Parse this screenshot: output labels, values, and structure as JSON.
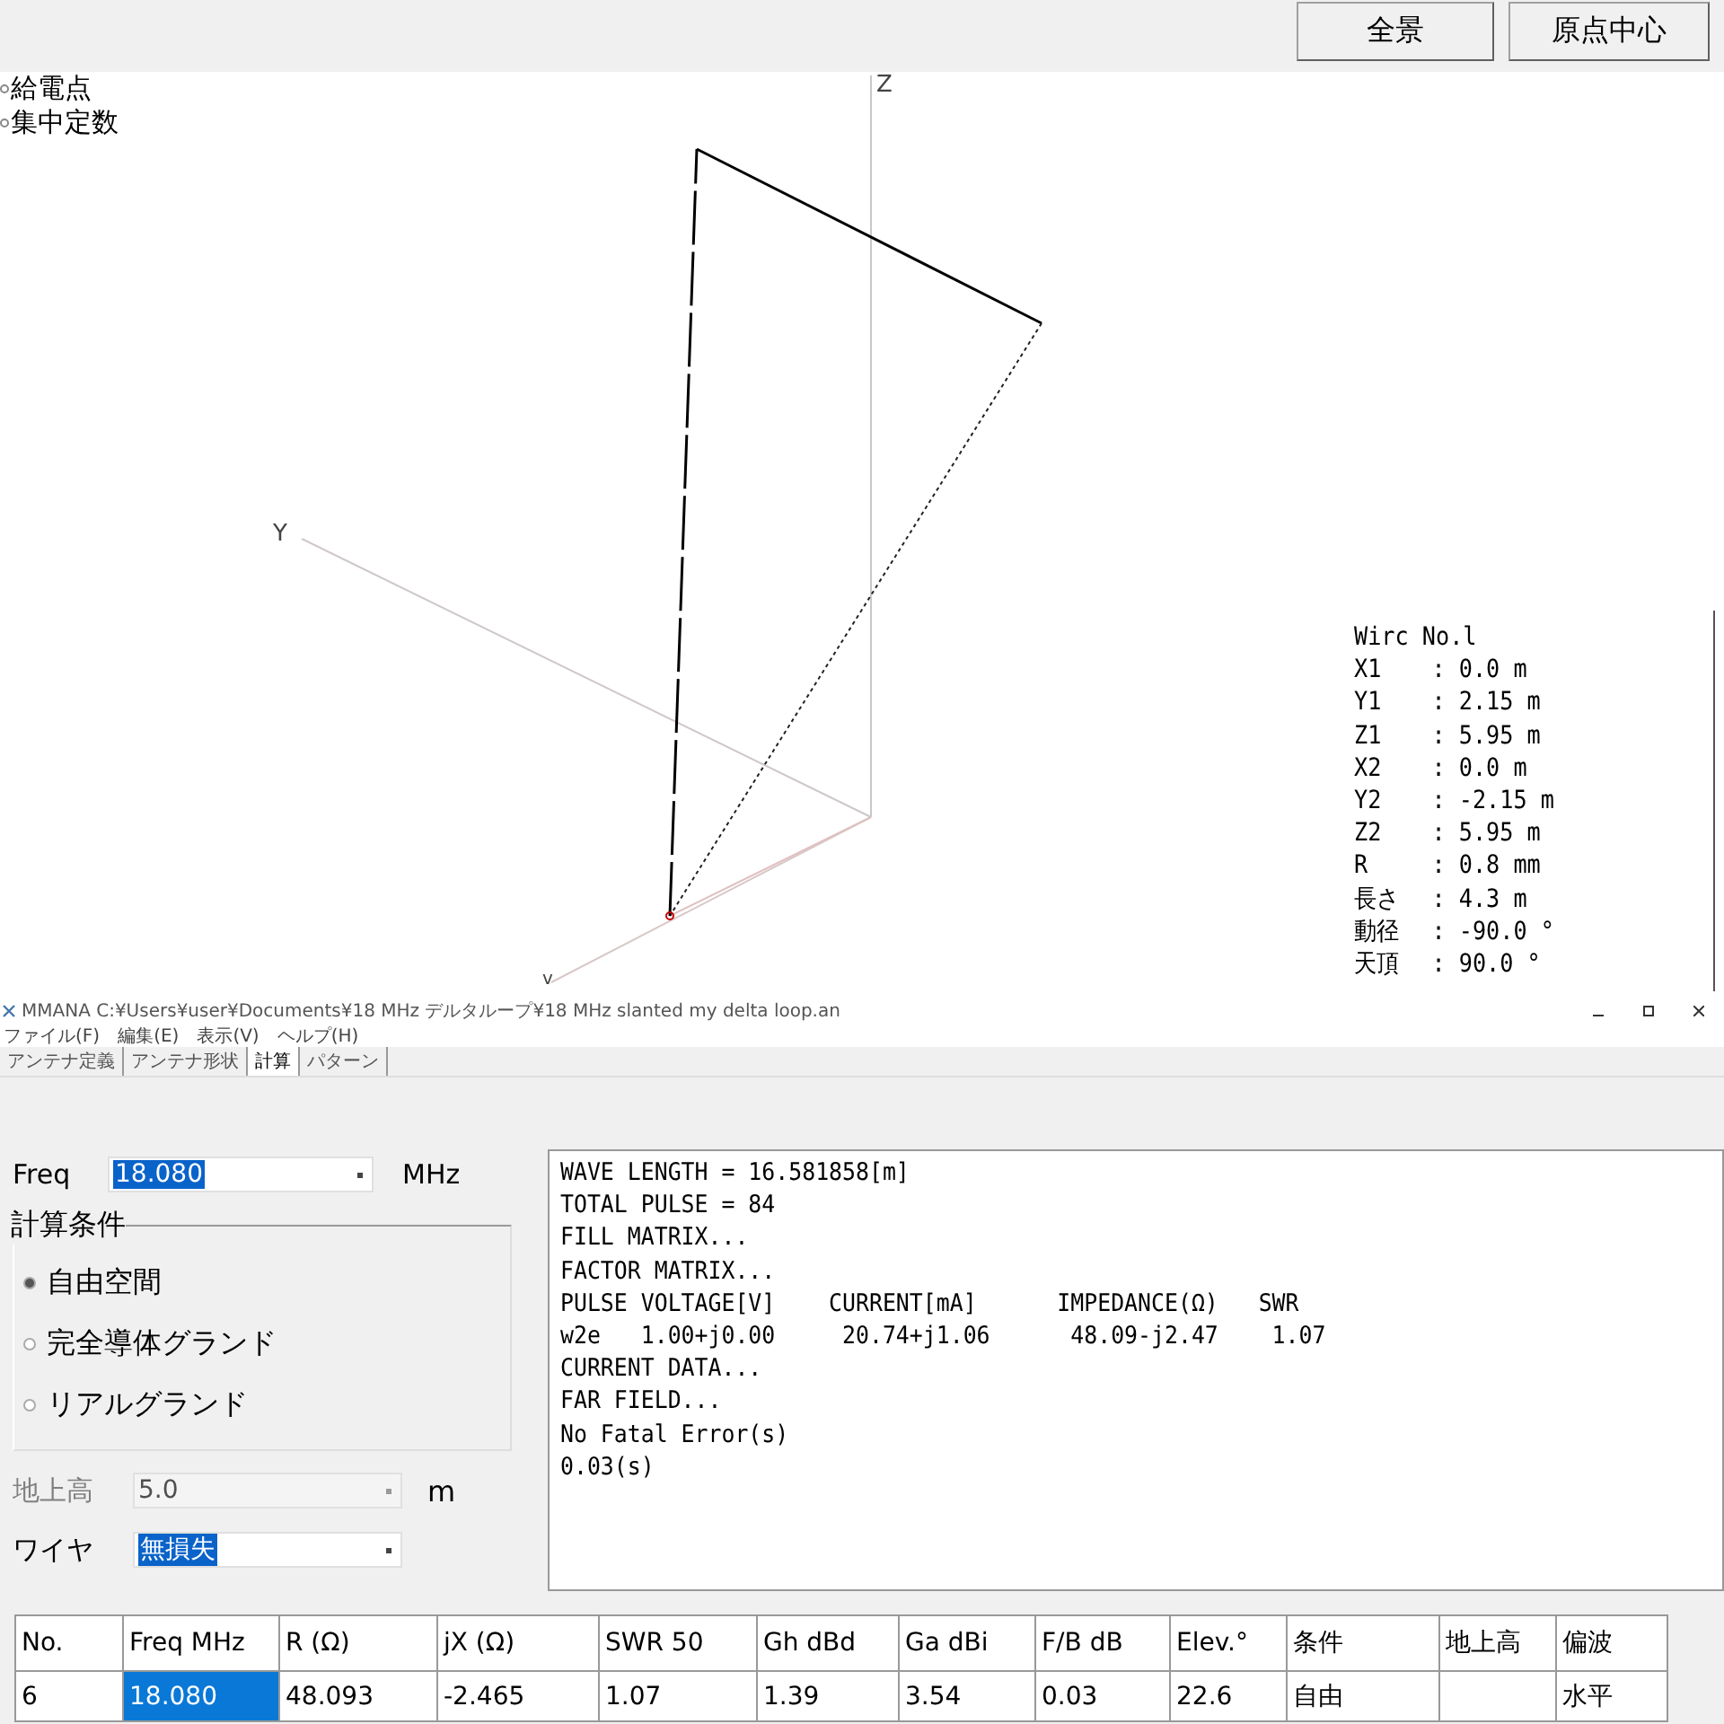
{
  "toolbar": {
    "buttons": [
      "全景",
      "原点中心"
    ]
  },
  "view": {
    "legend": [
      "給電点",
      "集中定数"
    ],
    "axes": {
      "z": "Z",
      "y": "Y",
      "x": "v"
    },
    "wire_info": {
      "title": "Wirc No.l",
      "rows": [
        {
          "label": "X1",
          "value": ": 0.0 m"
        },
        {
          "label": "Y1",
          "value": ": 2.15 m"
        },
        {
          "label": "Z1",
          "value": ": 5.95 m"
        },
        {
          "label": "X2",
          "value": ": 0.0 m"
        },
        {
          "label": "Y2",
          "value": ": -2.15 m"
        },
        {
          "label": "Z2",
          "value": ": 5.95 m"
        },
        {
          "label": "R",
          "value": ": 0.8 mm"
        },
        {
          "label": "長さ",
          "value": ": 4.3 m"
        },
        {
          "label": "動径",
          "value": ": -90.0 °"
        },
        {
          "label": "天頂",
          "value": ": 90.0 °"
        }
      ]
    }
  },
  "window": {
    "title": "MMANA   C:¥Users¥user¥Documents¥18 MHz デルタループ¥18 MHz slanted  my delta loop.an"
  },
  "menu": [
    "ファイル(F)",
    "編集(E)",
    "表示(V)",
    "ヘルプ(H)"
  ],
  "tabs": [
    {
      "label": "アンテナ定義",
      "selected": false
    },
    {
      "label": "アンテナ形状",
      "selected": false
    },
    {
      "label": "計算",
      "selected": true
    },
    {
      "label": "パターン",
      "selected": false
    }
  ],
  "form": {
    "freq": {
      "label": "Freq",
      "value": "18.080",
      "unit": "MHz"
    },
    "group": {
      "title": "計算条件",
      "options": [
        {
          "label": "自由空間",
          "selected": true
        },
        {
          "label": "完全導体グランド",
          "selected": false
        },
        {
          "label": "リアルグランド",
          "selected": false
        }
      ]
    },
    "height": {
      "label": "地上高",
      "value": "5.0",
      "unit": "m",
      "disabled": true
    },
    "wire": {
      "label": "ワイヤ",
      "value": "無損失"
    }
  },
  "output": [
    "WAVE LENGTH = 16.581858[m]",
    "TOTAL PULSE = 84",
    "FILL MATRIX...",
    "FACTOR MATRIX...",
    "PULSE VOLTAGE[V]    CURRENT[mA]      IMPEDANCE(Ω)   SWR",
    "w2e   1.00+j0.00     20.74+j1.06      48.09-j2.47    1.07",
    "CURRENT DATA...",
    "FAR FIELD...",
    "No Fatal Error(s)",
    "0.03(s)"
  ],
  "table": {
    "columns": [
      "No.",
      "Freq MHz",
      "R (Ω)",
      "jX (Ω)",
      "SWR 50",
      "Gh dBd",
      "Ga dBi",
      "F/B dB",
      "Elev.°",
      "条件",
      "地上高",
      "偏波"
    ],
    "rows": [
      {
        "cells": [
          {
            "text": "6",
            "selected": false
          },
          {
            "text": "18.080",
            "selected": true
          },
          {
            "text": "48.093",
            "selected": false
          },
          {
            "text": "-2.465",
            "selected": false
          },
          {
            "text": "1.07",
            "selected": false
          },
          {
            "text": "1.39",
            "selected": false
          },
          {
            "text": "3.54",
            "selected": false
          },
          {
            "text": "0.03",
            "selected": false
          },
          {
            "text": "22.6",
            "selected": false
          },
          {
            "text": "自由",
            "selected": false
          },
          {
            "selected": false
          },
          {
            "text": "水平",
            "selected": false
          }
        ]
      }
    ]
  }
}
